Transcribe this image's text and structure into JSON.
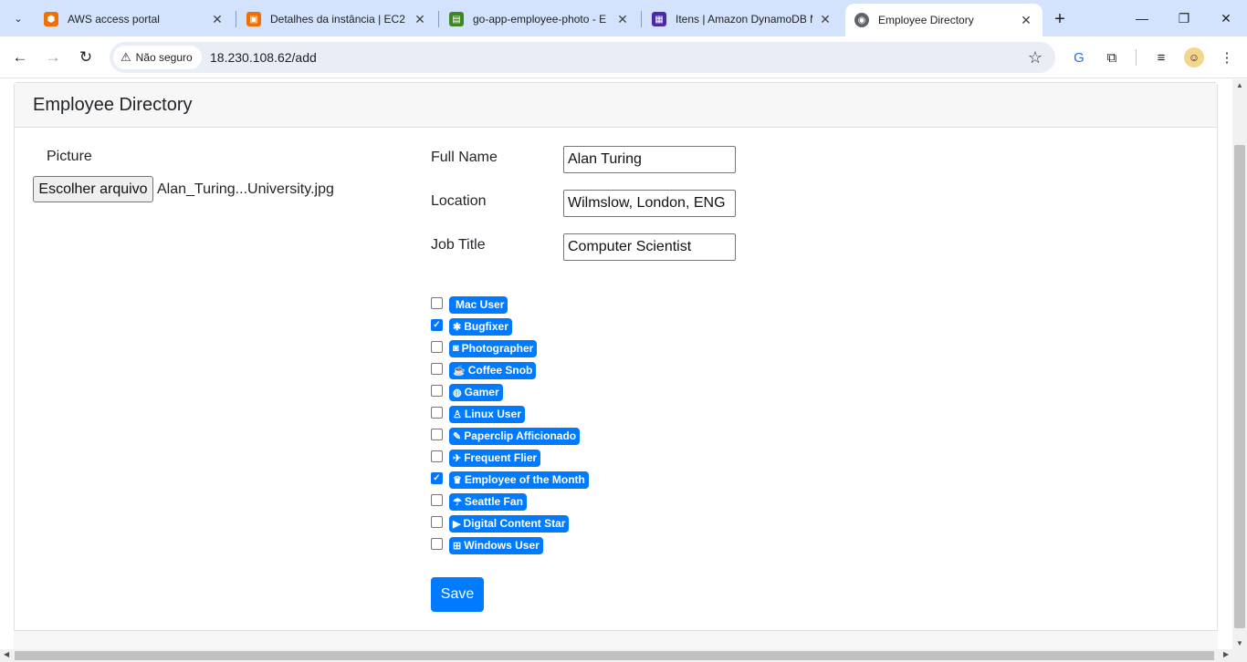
{
  "browser": {
    "tabs": [
      {
        "title": "AWS access portal",
        "icon": "aws-cube-icon",
        "color": "#ed7100"
      },
      {
        "title": "Detalhes da instância | EC2 | ",
        "icon": "ec2-icon",
        "color": "#ed7100"
      },
      {
        "title": "go-app-employee-photo - E",
        "icon": "s3-bucket-icon",
        "color": "#3f8624"
      },
      {
        "title": "Itens | Amazon DynamoDB M",
        "icon": "dynamodb-icon",
        "color": "#4d27aa"
      },
      {
        "title": "Employee Directory",
        "icon": "globe-icon",
        "color": "#5f6368"
      }
    ],
    "security_label": "Não seguro",
    "url": "18.230.108.62/add"
  },
  "page": {
    "header_title": "Employee Directory",
    "picture_label": "Picture",
    "file_button_label": "Escolher arquivo",
    "file_name": "Alan_Turing...University.jpg",
    "fields": {
      "full_name": {
        "label": "Full Name",
        "value": "Alan Turing"
      },
      "location": {
        "label": "Location",
        "value": "Wilmslow, London, ENG"
      },
      "job_title": {
        "label": "Job Title",
        "value": "Computer Scientist"
      }
    },
    "badges": [
      {
        "label": "Mac User",
        "icon": "apple-icon",
        "glyph": "",
        "checked": false
      },
      {
        "label": "Bugfixer",
        "icon": "bug-icon",
        "glyph": "✱",
        "checked": true
      },
      {
        "label": "Photographer",
        "icon": "camera-icon",
        "glyph": "◙",
        "checked": false
      },
      {
        "label": "Coffee Snob",
        "icon": "coffee-icon",
        "glyph": "☕",
        "checked": false
      },
      {
        "label": "Gamer",
        "icon": "gamepad-icon",
        "glyph": "◍",
        "checked": false
      },
      {
        "label": "Linux User",
        "icon": "linux-icon",
        "glyph": "♙",
        "checked": false
      },
      {
        "label": "Paperclip Afficionado",
        "icon": "paperclip-icon",
        "glyph": "✎",
        "checked": false
      },
      {
        "label": "Frequent Flier",
        "icon": "plane-icon",
        "glyph": "✈",
        "checked": false
      },
      {
        "label": "Employee of the Month",
        "icon": "trophy-icon",
        "glyph": "♛",
        "checked": true
      },
      {
        "label": "Seattle Fan",
        "icon": "umbrella-icon",
        "glyph": "☂",
        "checked": false
      },
      {
        "label": "Digital Content Star",
        "icon": "video-camera-icon",
        "glyph": "▶",
        "checked": false
      },
      {
        "label": "Windows User",
        "icon": "windows-icon",
        "glyph": "⊞",
        "checked": false
      }
    ],
    "save_label": "Save",
    "badge_color": "#007bff"
  }
}
